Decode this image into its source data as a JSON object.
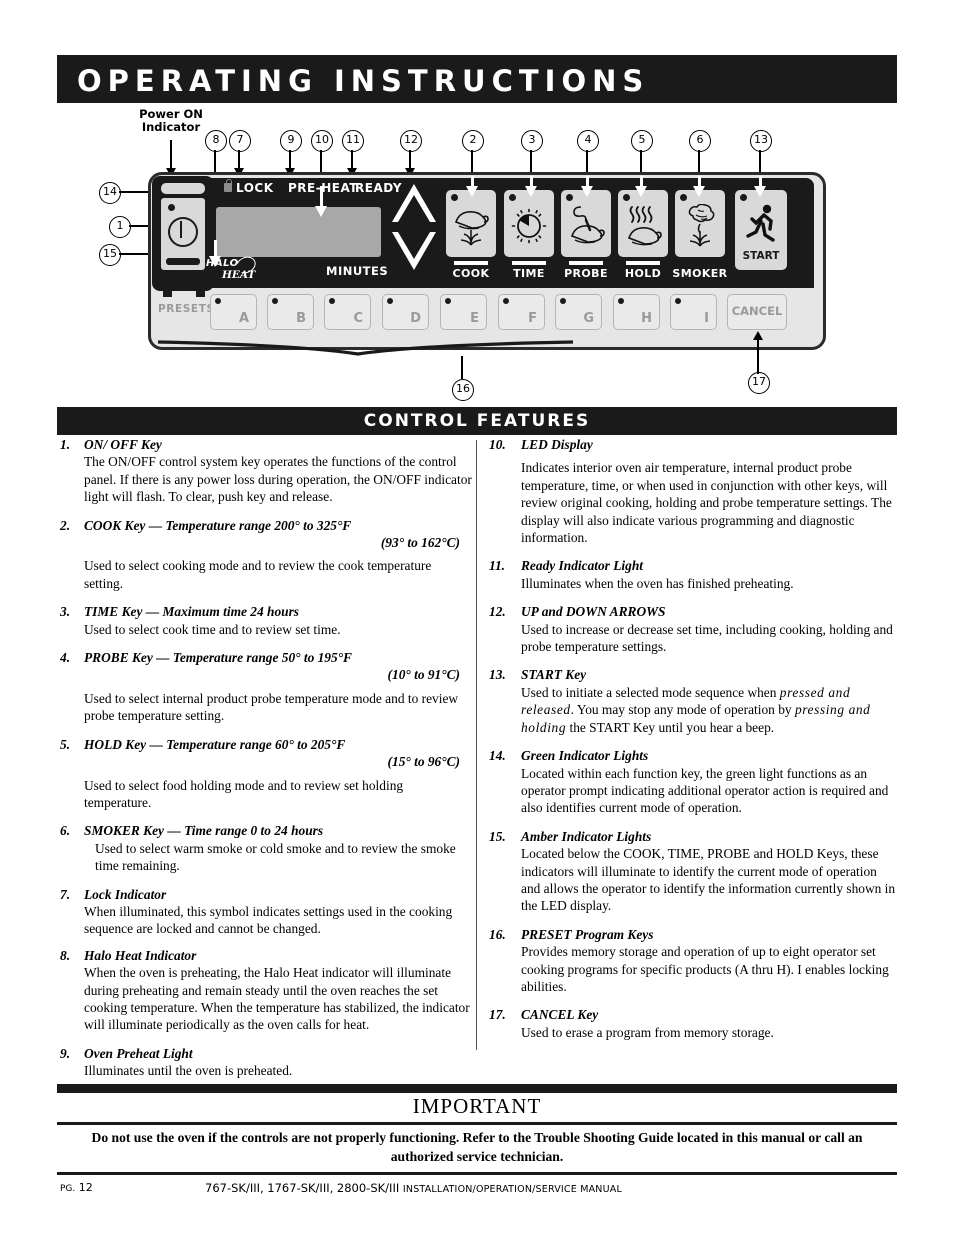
{
  "header": {
    "title": "OPERATING INSTRUCTIONS"
  },
  "diagram": {
    "power_label_line1": "Power ON",
    "power_label_line2": "Indicator",
    "callouts": [
      "1",
      "2",
      "3",
      "4",
      "5",
      "6",
      "7",
      "8",
      "9",
      "10",
      "11",
      "12",
      "13",
      "14",
      "15",
      "16",
      "17"
    ],
    "display": {
      "lock": "LOCK",
      "preheat": "PRE-HEAT",
      "ready": "READY",
      "minutes": "MINUTES",
      "halo_1": "HALO",
      "halo_2": "HEAT"
    },
    "function_keys": [
      {
        "label": "COOK",
        "icon": "roast-over-flame-icon"
      },
      {
        "label": "TIME",
        "icon": "clock-dial-icon"
      },
      {
        "label": "PROBE",
        "icon": "probe-in-roast-icon"
      },
      {
        "label": "HOLD",
        "icon": "roast-with-heat-waves-icon"
      },
      {
        "label": "SMOKER",
        "icon": "smoke-over-flame-icon"
      }
    ],
    "start_key": {
      "label": "START",
      "icon": "running-person-icon"
    },
    "presets_label": "PRESETS",
    "preset_keys": [
      "A",
      "B",
      "C",
      "D",
      "E",
      "F",
      "G",
      "H",
      "I"
    ],
    "cancel_key": "CANCEL"
  },
  "section": {
    "title": "CONTROL FEATURES"
  },
  "features_left": [
    {
      "num": "1.",
      "heading": "ON/ OFF Key",
      "body": "The ON/OFF control system key operates the functions of the control panel.  If there is any power loss during operation, the ON/OFF indicator light will flash.  To clear, push key and release."
    },
    {
      "num": "2.",
      "heading": "COOK Key — Temperature range 200° to 325°F",
      "range_metric": "(93° to 162°C)",
      "body": "Used to select cooking mode and to review the cook temperature setting."
    },
    {
      "num": "3.",
      "heading": "TIME Key — Maximum time 24 hours",
      "body": "Used to select cook time and to review set time."
    },
    {
      "num": "4.",
      "heading": "PROBE Key — Temperature range 50° to 195°F",
      "range_metric": "(10° to 91°C)",
      "body": "Used to select internal product probe temperature mode and to review probe temperature setting."
    },
    {
      "num": "5.",
      "heading": "HOLD Key — Temperature range 60° to 205°F",
      "range_metric": "(15° to 96°C)",
      "body": "Used to select food holding mode and to review set holding temperature."
    },
    {
      "num": "6.",
      "heading": "SMOKER Key — Time range 0 to 24 hours",
      "body": "Used to select warm smoke or cold smoke and to review the smoke time remaining."
    },
    {
      "num": "7.",
      "heading": "Lock Indicator",
      "body": "When illuminated, this symbol indicates settings used in the cooking sequence are locked and cannot be changed."
    },
    {
      "num": "8.",
      "heading": "Halo Heat Indicator",
      "body": "When the oven is preheating, the Halo Heat indicator will illuminate during preheating and remain steady until the oven reaches the set cooking temperature.  When the temperature has stabilized, the indicator will illuminate periodically as the oven calls for heat."
    },
    {
      "num": "9.",
      "heading": "Oven Preheat Light",
      "body": "Illuminates until the oven is preheated."
    }
  ],
  "features_right": [
    {
      "num": "10.",
      "heading": "LED Display",
      "body": "Indicates interior oven air temperature, internal product probe temperature, time, or when used in conjunction with other keys, will review original cooking, holding and probe temperature settings.  The display will also indicate various programming and diagnostic information."
    },
    {
      "num": "11.",
      "heading": "Ready Indicator Light",
      "body": "Illuminates when the oven has finished preheating."
    },
    {
      "num": "12.",
      "heading": "UP and DOWN ARROWS",
      "body": "Used to increase or decrease set time, including cooking, holding and probe temperature settings."
    },
    {
      "num": "13.",
      "heading": "START Key",
      "body_1": "Used to initiate a selected mode sequence when ",
      "em_1": "pressed and released",
      "body_2": ".  You may stop any mode of operation by ",
      "em_2": "pressing and holding",
      "body_3": " the START Key until you hear a beep."
    },
    {
      "num": "14.",
      "heading": "Green Indicator Lights",
      "body": "Located within each function key, the green light functions as an operator prompt indicating additional operator action is required and also identifies current mode of operation."
    },
    {
      "num": "15.",
      "heading": "Amber Indicator Lights",
      "body": "Located below the COOK, TIME, PROBE and HOLD Keys, these indicators will illuminate to identify the current mode of operation and allows the operator to identify the information currently shown in the LED display."
    },
    {
      "num": "16.",
      "heading": "PRESET Program Keys",
      "body": "Provides memory storage and operation of up to eight operator set cooking programs for specific products (A thru H).  I enables locking abilities."
    },
    {
      "num": "17.",
      "heading": "CANCEL Key",
      "body": "Used to erase a program from memory storage."
    }
  ],
  "important": {
    "title": "IMPORTANT",
    "text": "Do not use the oven if the controls are not properly functioning.  Refer to the Trouble Shooting Guide located in this manual or call an authorized service technician."
  },
  "footer": {
    "page_prefix": "PG.",
    "page_number": "12",
    "models": "767-SK/III, 1767-SK/III, 2800-SK/III",
    "manual": "INSTALLATION/OPERATION/SERVICE MANUAL"
  }
}
